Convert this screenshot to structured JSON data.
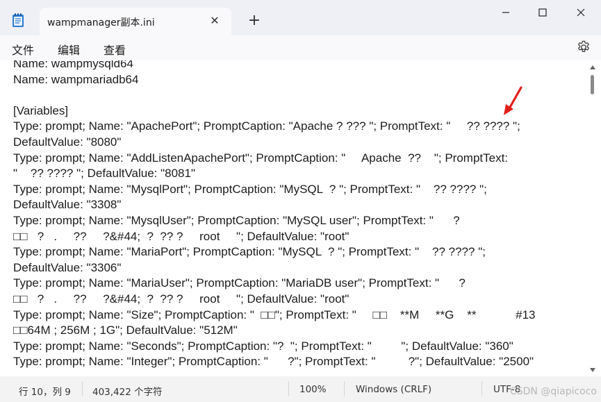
{
  "window": {
    "tab_title": "wampmanager副本.ini",
    "tab_close_icon": "close-icon",
    "new_tab_icon": "plus-icon",
    "app_icon": "notepad-icon",
    "controls": [
      "minimize-icon",
      "maximize-icon",
      "close-icon"
    ]
  },
  "menu": {
    "items": [
      "文件",
      "编辑",
      "查看"
    ],
    "settings_icon": "gear-icon"
  },
  "editor": {
    "lines": [
      "Name: wampmysqld64",
      "Name: wampmariadb64",
      "",
      "[Variables]",
      "Type: prompt; Name: \"ApachePort\"; PromptCaption: \"Apache ? ??? \"; PromptText: \"     ?? ???? \";",
      "DefaultValue: \"8080\"",
      "Type: prompt; Name: \"AddListenApachePort\"; PromptCaption: \"     Apache  ??    \"; PromptText:",
      "\"    ?? ???? \"; DefaultValue: \"8081\"",
      "Type: prompt; Name: \"MysqlPort\"; PromptCaption: \"MySQL  ? \"; PromptText: \"    ?? ???? \";",
      "DefaultValue: \"3308\"",
      "Type: prompt; Name: \"MysqlUser\"; PromptCaption: \"MySQL user\"; PromptText: \"      ?",
      "□□   ?   .     ??     ?&#44;  ?  ?? ?     root     \"; DefaultValue: \"root\"",
      "Type: prompt; Name: \"MariaPort\"; PromptCaption: \"MySQL  ? \"; PromptText: \"    ?? ???? \";",
      "DefaultValue: \"3306\"",
      "Type: prompt; Name: \"MariaUser\"; PromptCaption: \"MariaDB user\"; PromptText: \"      ?",
      "□□   ?   .     ??     ?&#44;  ?  ?? ?     root     \"; DefaultValue: \"root\"",
      "Type: prompt; Name: \"Size\"; PromptCaption: \"  □□\"; PromptText: \"     □□    **M     **G    **            #13",
      "□□64M ; 256M ; 1G\"; DefaultValue: \"512M\"",
      "Type: prompt; Name: \"Seconds\"; PromptCaption: \"?  \"; PromptText: \"         \"; DefaultValue: \"360\"",
      "Type: prompt; Name: \"Integer\"; PromptCaption: \"      ?\"; PromptText: \"          ?\"; DefaultValue: \"2500\""
    ]
  },
  "status": {
    "position": "行 10，列 9",
    "char_count": "403,422 个字符",
    "zoom": "100%",
    "line_ending": "Windows (CRLF)",
    "encoding": "UTF-8"
  },
  "watermark": "CSDN @qiapicoco",
  "colors": {
    "titlebar_bg": "#eef0f6",
    "tab_bg": "#f9f9fb",
    "annotation_arrow": "#e0201b",
    "statusbar_bg": "#f3f3f3"
  }
}
